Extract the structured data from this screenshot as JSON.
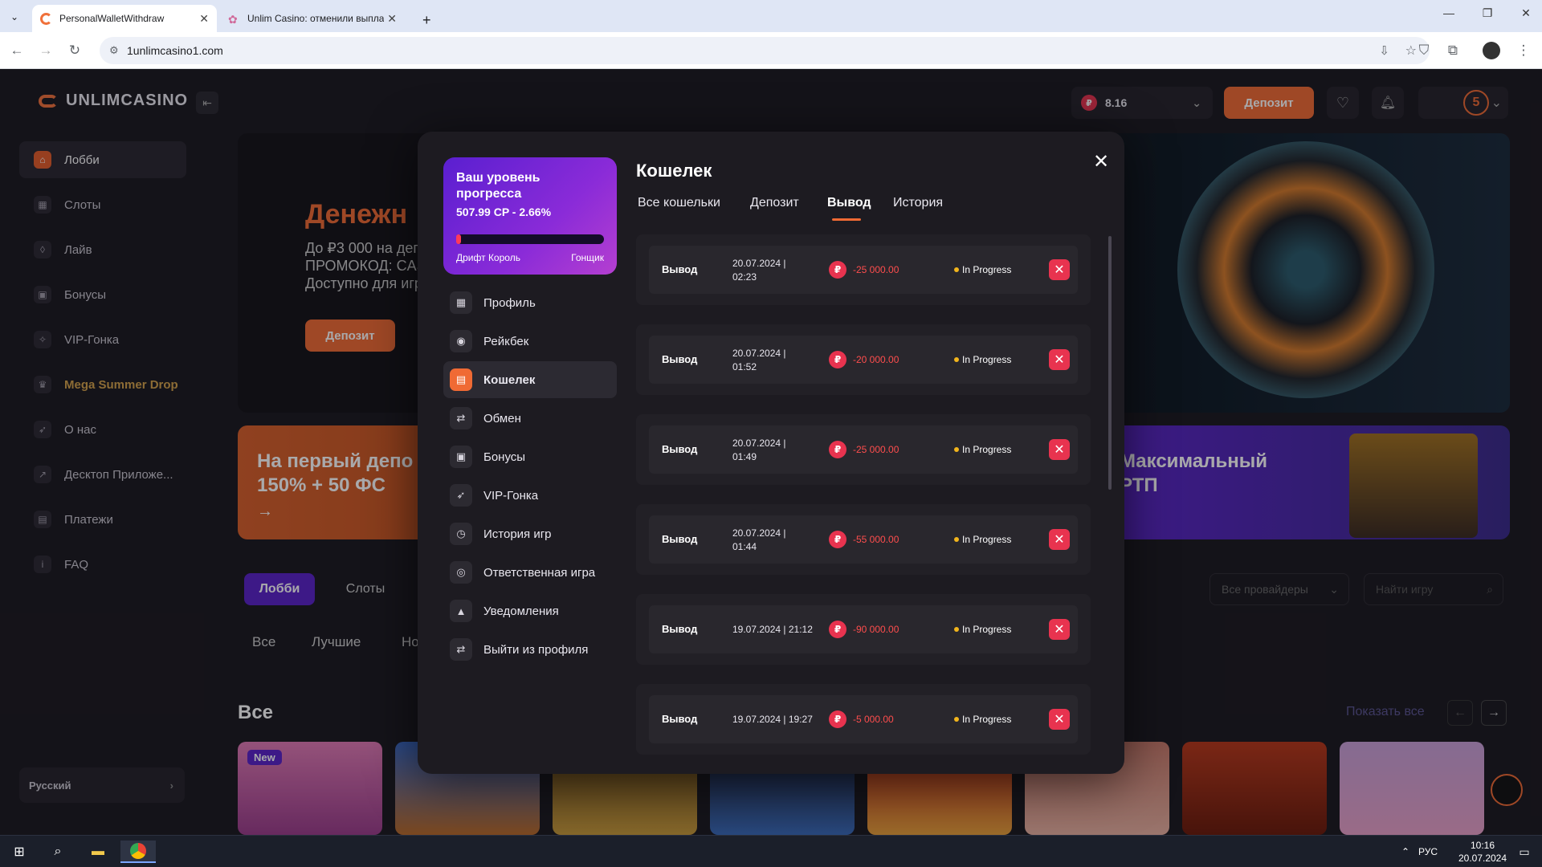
{
  "browser": {
    "tabs": [
      {
        "title": "PersonalWalletWithdraw",
        "active": true
      },
      {
        "title": "Unlim Casino: отменили выпла",
        "active": false
      }
    ],
    "url": "1unlimcasino1.com"
  },
  "site": {
    "logo": "UNLIMCASINO",
    "balance": "8.16",
    "deposit_button": "Депозит",
    "level_badge": "5"
  },
  "sidebar": {
    "items": [
      {
        "label": "Лобби",
        "icon": "home-icon",
        "active": true
      },
      {
        "label": "Слоты",
        "icon": "grid-icon"
      },
      {
        "label": "Лайв",
        "icon": "live-icon"
      },
      {
        "label": "Бонусы",
        "icon": "gift-icon"
      },
      {
        "label": "VIP-Гонка",
        "icon": "vip-icon"
      },
      {
        "label": "Mega Summer Drop",
        "icon": "trophy-icon",
        "highlight": true
      },
      {
        "label": "О нас",
        "icon": "rocket-icon"
      },
      {
        "label": "Десктоп Приложе...",
        "icon": "external-icon"
      },
      {
        "label": "Платежи",
        "icon": "wallet-icon"
      },
      {
        "label": "FAQ",
        "icon": "info-icon"
      }
    ],
    "language": "Русский"
  },
  "background": {
    "hero_title": "Денежн",
    "hero_line1": "До ₽3 000 на деп",
    "hero_line2": "ПРОМОКОД: CAS",
    "hero_line3": "Доступно для игр",
    "hero_button": "Депозит",
    "promo1": "На первый депо",
    "promo1_sub": "150% + 50 ФС",
    "promo2": "Максимальный",
    "promo2_sub": "РТП",
    "tabs": [
      "Лобби",
      "Слоты"
    ],
    "filters": [
      "Все",
      "Лучшие",
      "Но"
    ],
    "providers": "Все провайдеры",
    "search_placeholder": "Найти игру",
    "section_title": "Все",
    "show_all": "Показать все",
    "badge_new": "New"
  },
  "modal": {
    "progress": {
      "title": "Ваш уровень прогресса",
      "value": "507.99 CP - 2.66%",
      "fraction": 0.0266,
      "from": "Дрифт Король",
      "to": "Гонщик"
    },
    "menu": [
      {
        "label": "Профиль",
        "icon": "profile-icon"
      },
      {
        "label": "Рейкбек",
        "icon": "coins-icon"
      },
      {
        "label": "Кошелек",
        "icon": "wallet-icon",
        "active": true
      },
      {
        "label": "Обмен",
        "icon": "exchange-icon"
      },
      {
        "label": "Бонусы",
        "icon": "gift-icon"
      },
      {
        "label": "VIP-Гонка",
        "icon": "rocket-icon"
      },
      {
        "label": "История игр",
        "icon": "clock-icon"
      },
      {
        "label": "Ответственная игра",
        "icon": "eye-icon"
      },
      {
        "label": "Уведомления",
        "icon": "bell-icon"
      },
      {
        "label": "Выйти из профиля",
        "icon": "logout-icon"
      }
    ],
    "title": "Кошелек",
    "tabs": [
      "Все кошельки",
      "Депозит",
      "Вывод",
      "История"
    ],
    "active_tab": "Вывод",
    "transactions": [
      {
        "type": "Вывод",
        "date": "20.07.2024 | 02:23",
        "amount": "-25 000.00",
        "status": "In Progress"
      },
      {
        "type": "Вывод",
        "date": "20.07.2024 | 01:52",
        "amount": "-20 000.00",
        "status": "In Progress"
      },
      {
        "type": "Вывод",
        "date": "20.07.2024 | 01:49",
        "amount": "-25 000.00",
        "status": "In Progress"
      },
      {
        "type": "Вывод",
        "date": "20.07.2024 | 01:44",
        "amount": "-55 000.00",
        "status": "In Progress"
      },
      {
        "type": "Вывод",
        "date": "19.07.2024 | 21:12",
        "amount": "-90 000.00",
        "status": "In Progress"
      },
      {
        "type": "Вывод",
        "date": "19.07.2024 | 19:27",
        "amount": "-5 000.00",
        "status": "In Progress"
      }
    ],
    "currency_symbol": "₽",
    "accent": "#f06a34",
    "negative": "#ff4d4d"
  },
  "taskbar": {
    "lang": "РУС",
    "time": "10:16",
    "date": "20.07.2024"
  }
}
